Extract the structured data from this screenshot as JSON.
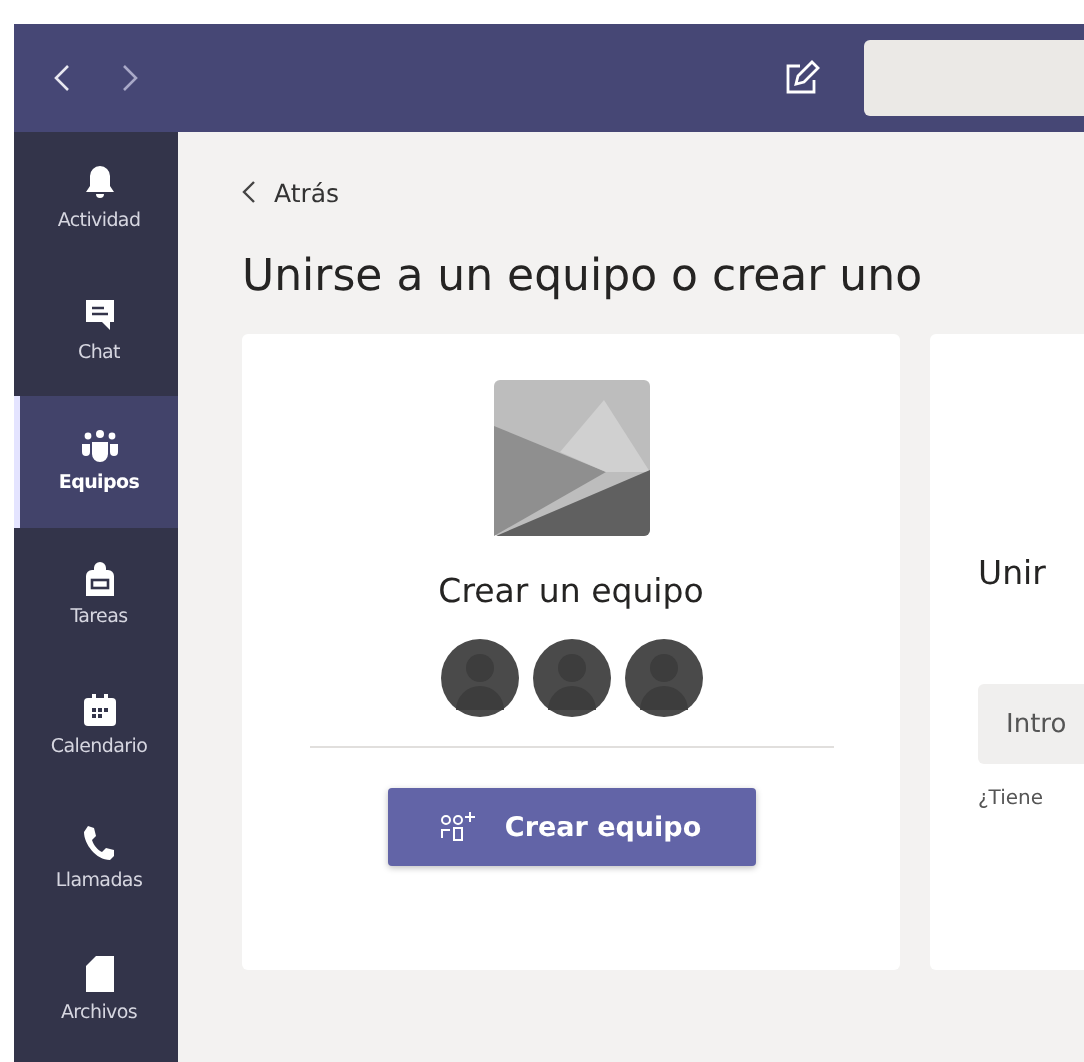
{
  "sidebar": {
    "items": [
      {
        "label": "Actividad",
        "selected": false
      },
      {
        "label": "Chat",
        "selected": false
      },
      {
        "label": "Equipos",
        "selected": true
      },
      {
        "label": "Tareas",
        "selected": false
      },
      {
        "label": "Calendario",
        "selected": false
      },
      {
        "label": "Llamadas",
        "selected": false
      },
      {
        "label": "Archivos",
        "selected": false
      }
    ]
  },
  "back_link": "Atrás",
  "title": "Unirse a un equipo o crear uno",
  "create_card": {
    "title": "Crear un equipo",
    "button": "Crear equipo"
  },
  "join_card": {
    "title": "Unir",
    "field_placeholder": "Intro",
    "hint": "¿Tiene"
  }
}
